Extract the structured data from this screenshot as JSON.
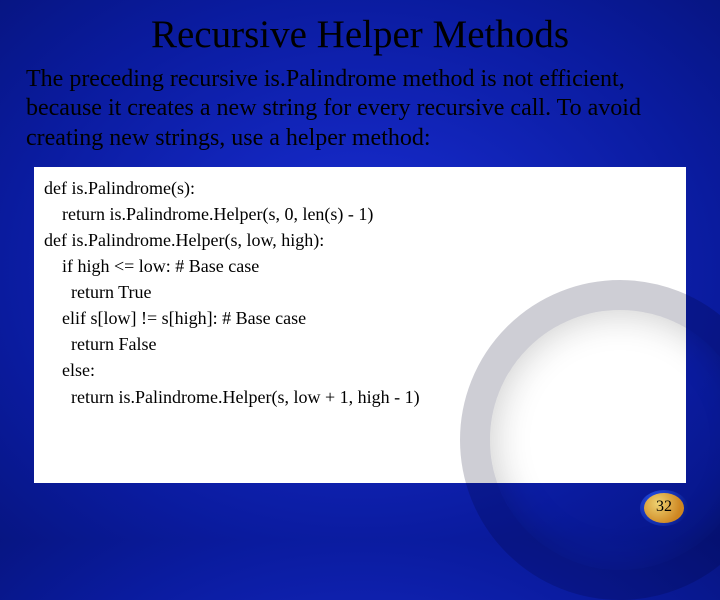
{
  "title": "Recursive Helper Methods",
  "paragraph": "The preceding recursive is.Palindrome method is not efficient, because it creates a new string for every recursive call. To avoid creating new strings, use a helper method:",
  "code": {
    "l1": "def is.Palindrome(s):",
    "l2": "    return is.Palindrome.Helper(s, 0, len(s) - 1)",
    "l3": "",
    "l4": "def is.Palindrome.Helper(s, low, high):",
    "l5": "    if high <= low: # Base case",
    "l6": "      return True",
    "l7": "    elif s[low] != s[high]: # Base case",
    "l8": "      return False",
    "l9": "    else:",
    "l10": "      return is.Palindrome.Helper(s, low + 1, high - 1)"
  },
  "page_number": "32"
}
